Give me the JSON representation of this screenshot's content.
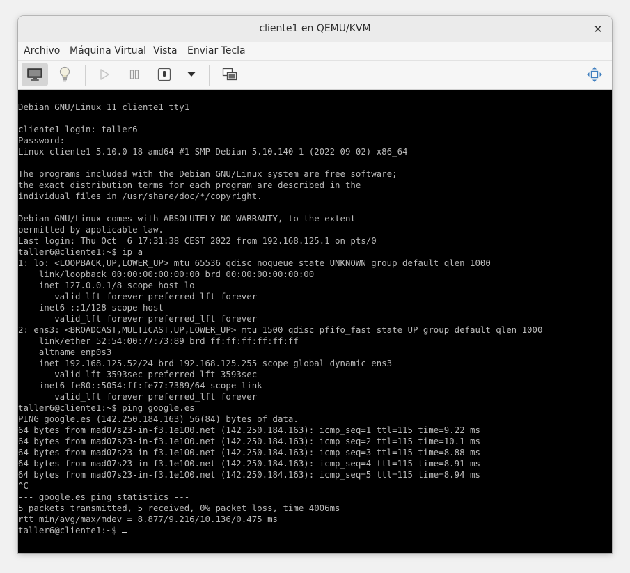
{
  "window": {
    "title": "cliente1 en QEMU/KVM",
    "close_glyph": "✕"
  },
  "menu": {
    "items": [
      "Archivo",
      "Máquina Virtual",
      "Vista",
      "Enviar Tecla"
    ]
  },
  "toolbar": {
    "buttons": [
      {
        "icon": "monitor-icon",
        "active": true
      },
      {
        "icon": "lightbulb-icon",
        "active": false
      },
      {
        "icon": "play-icon",
        "active": false
      },
      {
        "icon": "pause-icon",
        "active": false
      },
      {
        "icon": "power-icon",
        "active": false
      },
      {
        "icon": "chevron-down-icon",
        "active": false
      },
      {
        "icon": "snapshots-icon",
        "active": false
      },
      {
        "icon": "move-arrows-icon",
        "active": false
      }
    ]
  },
  "console": {
    "lines": [
      "Debian GNU/Linux 11 cliente1 tty1",
      "",
      "cliente1 login: taller6",
      "Password:",
      "Linux cliente1 5.10.0-18-amd64 #1 SMP Debian 5.10.140-1 (2022-09-02) x86_64",
      "",
      "The programs included with the Debian GNU/Linux system are free software;",
      "the exact distribution terms for each program are described in the",
      "individual files in /usr/share/doc/*/copyright.",
      "",
      "Debian GNU/Linux comes with ABSOLUTELY NO WARRANTY, to the extent",
      "permitted by applicable law.",
      "Last login: Thu Oct  6 17:31:38 CEST 2022 from 192.168.125.1 on pts/0",
      "taller6@cliente1:~$ ip a",
      "1: lo: <LOOPBACK,UP,LOWER_UP> mtu 65536 qdisc noqueue state UNKNOWN group default qlen 1000",
      "    link/loopback 00:00:00:00:00:00 brd 00:00:00:00:00:00",
      "    inet 127.0.0.1/8 scope host lo",
      "       valid_lft forever preferred_lft forever",
      "    inet6 ::1/128 scope host",
      "       valid_lft forever preferred_lft forever",
      "2: ens3: <BROADCAST,MULTICAST,UP,LOWER_UP> mtu 1500 qdisc pfifo_fast state UP group default qlen 1000",
      "    link/ether 52:54:00:77:73:89 brd ff:ff:ff:ff:ff:ff",
      "    altname enp0s3",
      "    inet 192.168.125.52/24 brd 192.168.125.255 scope global dynamic ens3",
      "       valid_lft 3593sec preferred_lft 3593sec",
      "    inet6 fe80::5054:ff:fe77:7389/64 scope link",
      "       valid_lft forever preferred_lft forever",
      "taller6@cliente1:~$ ping google.es",
      "PING google.es (142.250.184.163) 56(84) bytes of data.",
      "64 bytes from mad07s23-in-f3.1e100.net (142.250.184.163): icmp_seq=1 ttl=115 time=9.22 ms",
      "64 bytes from mad07s23-in-f3.1e100.net (142.250.184.163): icmp_seq=2 ttl=115 time=10.1 ms",
      "64 bytes from mad07s23-in-f3.1e100.net (142.250.184.163): icmp_seq=3 ttl=115 time=8.88 ms",
      "64 bytes from mad07s23-in-f3.1e100.net (142.250.184.163): icmp_seq=4 ttl=115 time=8.91 ms",
      "64 bytes from mad07s23-in-f3.1e100.net (142.250.184.163): icmp_seq=5 ttl=115 time=8.94 ms",
      "^C",
      "--- google.es ping statistics ---",
      "5 packets transmitted, 5 received, 0% packet loss, time 4006ms",
      "rtt min/avg/max/mdev = 8.877/9.216/10.136/0.475 ms"
    ],
    "prompt": "taller6@cliente1:~$ "
  },
  "colors": {
    "terminal_bg": "#000000",
    "terminal_fg": "#b9b9b9",
    "titlebar_bg": "#ebebeb",
    "toolbar_bg": "#f6f6f6"
  }
}
